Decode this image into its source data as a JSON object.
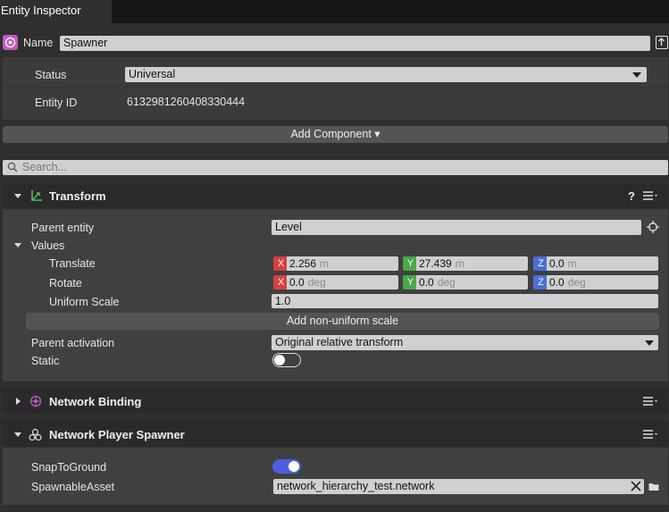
{
  "window": {
    "tab_title": "Entity Inspector"
  },
  "entity": {
    "name_label": "Name",
    "name_value": "Spawner",
    "status_label": "Status",
    "status_value": "Universal",
    "id_label": "Entity ID",
    "id_value": "6132981260408330444"
  },
  "toolbar": {
    "add_component": "Add Component ▾"
  },
  "search": {
    "placeholder": "Search..."
  },
  "transform": {
    "title": "Transform",
    "help": "?",
    "parent_entity_label": "Parent entity",
    "parent_entity_value": "Level",
    "values_label": "Values",
    "translate_label": "Translate",
    "rotate_label": "Rotate",
    "uniform_scale_label": "Uniform Scale",
    "uniform_scale_value": "1.0",
    "translate": {
      "x": "2.256",
      "y": "27.439",
      "z": "0.0",
      "unit": "m"
    },
    "rotate": {
      "x": "0.0",
      "y": "0.0",
      "z": "0.0",
      "unit": "deg"
    },
    "axis_x": "X",
    "axis_y": "Y",
    "axis_z": "Z",
    "add_nonuniform": "Add non-uniform scale",
    "parent_activation_label": "Parent activation",
    "parent_activation_value": "Original relative transform",
    "static_label": "Static",
    "static_on": false
  },
  "network_binding": {
    "title": "Network Binding"
  },
  "player_spawner": {
    "title": "Network Player Spawner",
    "snap_label": "SnapToGround",
    "snap_on": true,
    "asset_label": "SpawnableAsset",
    "asset_value": "network_hierarchy_test.network"
  },
  "colors": {
    "toggle_on": "#4a5fe0",
    "axis_x": "#d64040",
    "axis_y": "#4aa84a",
    "axis_z": "#4a6fd6"
  }
}
